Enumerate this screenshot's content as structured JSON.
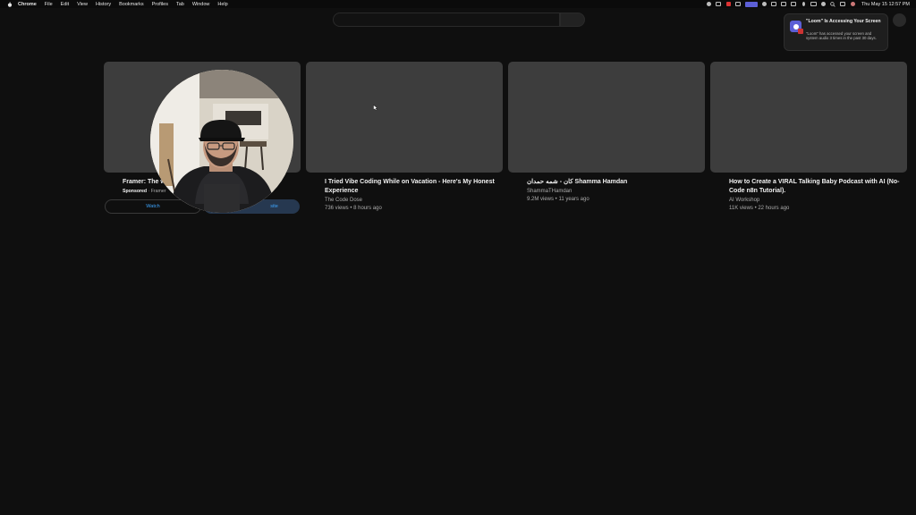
{
  "menubar": {
    "app_name": "Chrome",
    "menus": [
      "File",
      "Edit",
      "View",
      "History",
      "Bookmarks",
      "Profiles",
      "Tab",
      "Window",
      "Help"
    ],
    "clock": "Thu May 15  12:57 PM"
  },
  "notification": {
    "title": "\"Loom\" Is Accessing Your Screen",
    "body": "\"Loom\" has accessed your screen and system audio 3 times in the past 30 days."
  },
  "videos": [
    {
      "title": "Framer: The w",
      "sponsored_label": "Sponsored",
      "advertiser": "Framer",
      "watch_label": "Watch",
      "visit_label": "site"
    },
    {
      "title": "I Tried Vibe Coding While on Vacation - Here's My Honest Experience",
      "channel": "The Code Dose",
      "stats": "736 views • 8 hours ago"
    },
    {
      "title": "كان - شمه حمدان Shamma Hamdan",
      "channel": "ShammaTHamdan",
      "stats": "9.2M views • 11 years ago"
    },
    {
      "title": "How to Create a VIRAL Talking Baby Podcast with AI (No-Code n8n Tutorial).",
      "channel": "AI Workshop",
      "stats": "11K views • 22 hours ago"
    }
  ]
}
